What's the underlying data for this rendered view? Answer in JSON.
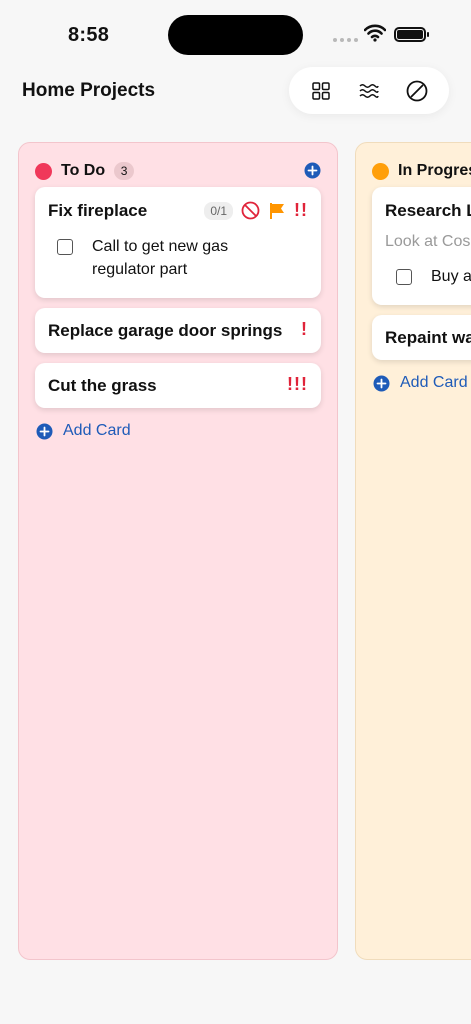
{
  "status_bar": {
    "time": "8:58"
  },
  "header": {
    "title": "Home Projects"
  },
  "toolbar": {
    "buttons": [
      "grid-view",
      "filter",
      "hide"
    ]
  },
  "colors": {
    "accent": "#1e5bb8",
    "todo_dot": "#f0385a",
    "progress_dot": "#ff9f0a",
    "priority": "#e0243a",
    "flag": "#ff9500"
  },
  "columns": [
    {
      "name": "To Do",
      "count": "3",
      "cards": [
        {
          "title": "Fix fireplace",
          "checklist_progress": "0/1",
          "priority": "!!",
          "checklist": [
            "Call to get new gas regulator part"
          ]
        },
        {
          "title": "Replace garage door springs",
          "priority": "!"
        },
        {
          "title": "Cut the grass",
          "priority": "!!!"
        }
      ],
      "add_card_label": "Add Card"
    },
    {
      "name": "In Progress",
      "cards": [
        {
          "title": "Research L",
          "subtitle": "Look at Cos",
          "checklist": [
            "Buy a"
          ]
        },
        {
          "title": "Repaint wa"
        }
      ],
      "add_card_label": "Add Card"
    }
  ]
}
